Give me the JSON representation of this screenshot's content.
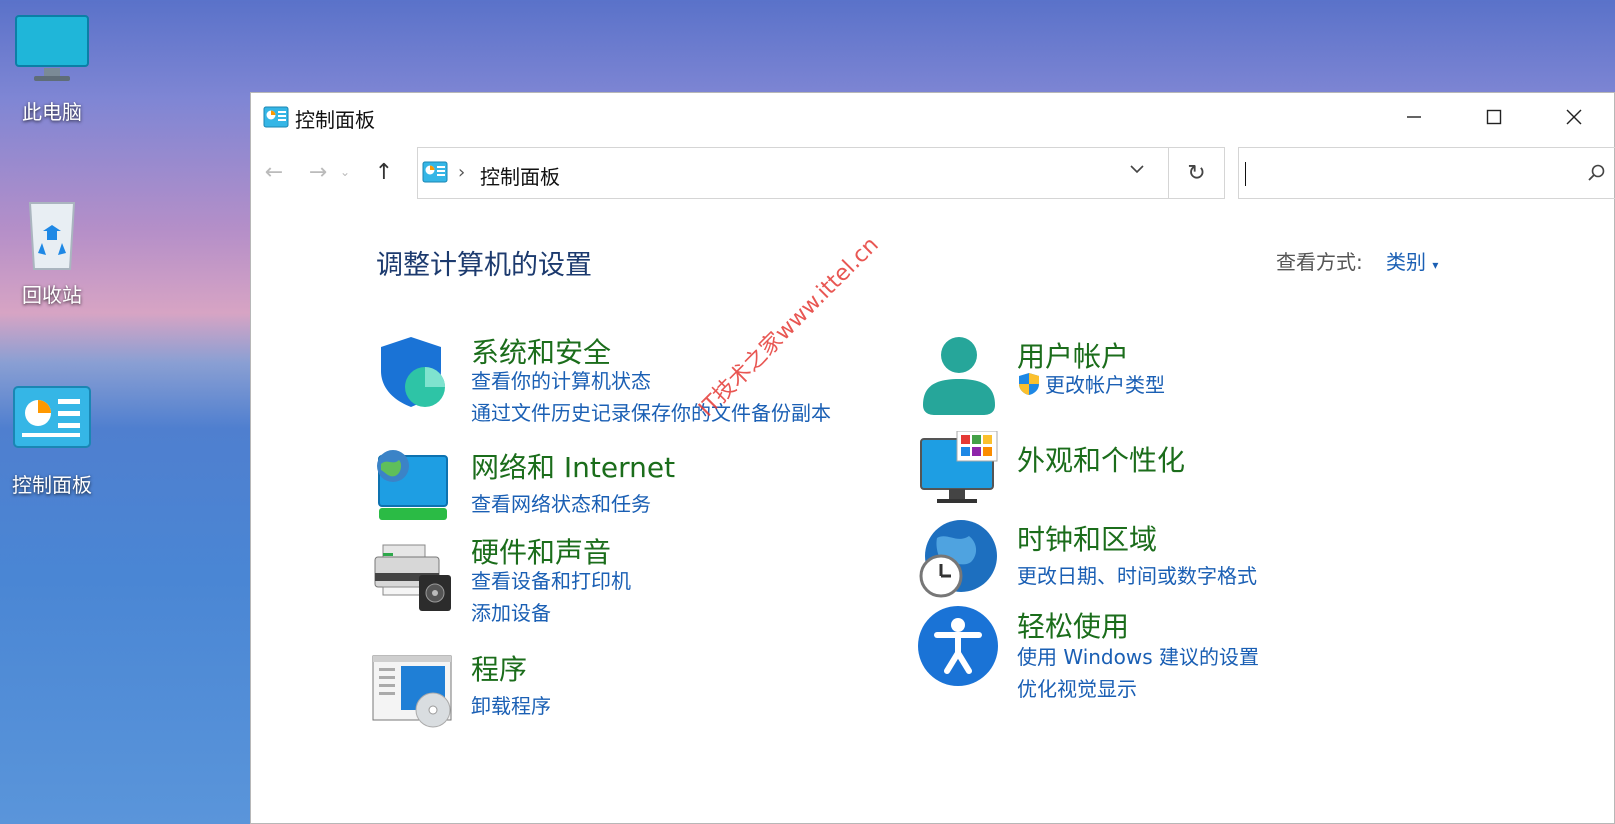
{
  "desktop": {
    "icons": [
      {
        "label": "此电脑"
      },
      {
        "label": "回收站"
      },
      {
        "label": "控制面板"
      }
    ]
  },
  "window": {
    "title": "控制面板",
    "address_path": "控制面板",
    "search_placeholder": "",
    "heading": "调整计算机的设置",
    "view_by_label": "查看方式:",
    "view_by_value": "类别"
  },
  "categories": [
    {
      "title": "系统和安全",
      "links": [
        "查看你的计算机状态",
        "通过文件历史记录保存你的文件备份副本"
      ]
    },
    {
      "title": "网络和 Internet",
      "links": [
        "查看网络状态和任务"
      ]
    },
    {
      "title": "硬件和声音",
      "links": [
        "查看设备和打印机",
        "添加设备"
      ]
    },
    {
      "title": "程序",
      "links": [
        "卸载程序"
      ]
    },
    {
      "title": "用户帐户",
      "links": [
        "更改帐户类型"
      ]
    },
    {
      "title": "外观和个性化",
      "links": []
    },
    {
      "title": "时钟和区域",
      "links": [
        "更改日期、时间或数字格式"
      ]
    },
    {
      "title": "轻松使用",
      "links": [
        "使用 Windows 建议的设置",
        "优化视觉显示"
      ]
    }
  ],
  "watermark": "IT技术之家www.ittel.cn",
  "colors": {
    "title_green": "#1b6d1b",
    "link_blue": "#1a5fb4",
    "heading_navy": "#1c3a6e"
  }
}
